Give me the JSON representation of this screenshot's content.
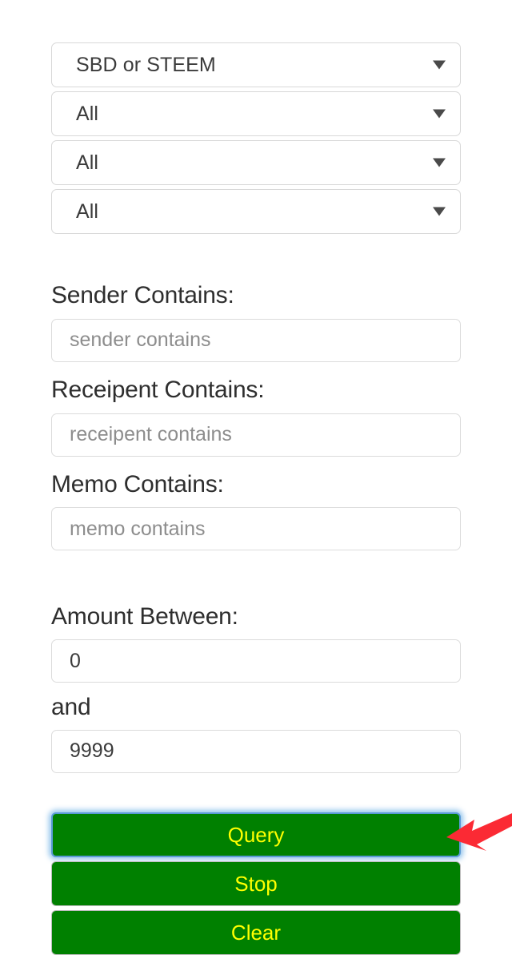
{
  "colors": {
    "button_bg": "#008000",
    "button_text": "#ffff00",
    "focus_ring": "#5a9ad6",
    "arrow": "#fb2a34",
    "label_text": "#2e2e2e",
    "placeholder_text": "#8d8d8d",
    "field_border": "#dcdcdc",
    "page_bg": "#ffffff"
  },
  "filters": {
    "selects": [
      {
        "name": "currency-select",
        "value": "SBD or STEEM",
        "icon": "chevron-down-icon"
      },
      {
        "name": "type-select",
        "value": "All",
        "icon": "chevron-down-icon"
      },
      {
        "name": "direction-select",
        "value": "All",
        "icon": "chevron-down-icon"
      },
      {
        "name": "period-select",
        "value": "All",
        "icon": "chevron-down-icon"
      }
    ]
  },
  "contains": {
    "sender": {
      "label": "Sender Contains:",
      "placeholder": "sender contains",
      "value": ""
    },
    "receipent": {
      "label": "Receipent Contains:",
      "placeholder": "receipent contains",
      "value": ""
    },
    "memo": {
      "label": "Memo Contains:",
      "placeholder": "memo contains",
      "value": ""
    }
  },
  "amount": {
    "label": "Amount Between:",
    "and_label": "and",
    "min": {
      "value": "0",
      "placeholder": "0"
    },
    "max": {
      "value": "9999",
      "placeholder": "9999"
    }
  },
  "actions": {
    "query": {
      "label": "Query",
      "focused": true
    },
    "stop": {
      "label": "Stop",
      "focused": false
    },
    "clear": {
      "label": "Clear",
      "focused": false
    }
  },
  "annotation": {
    "arrow": {
      "name": "red-arrow-pointer",
      "points_to": "query-button",
      "direction": "left"
    }
  }
}
